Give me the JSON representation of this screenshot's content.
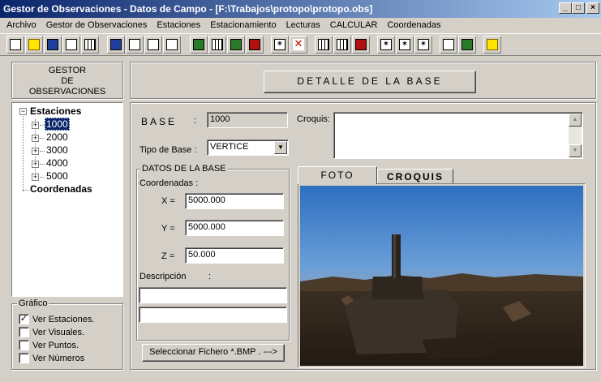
{
  "window": {
    "title": "Gestor de Observaciones - Datos de Campo - [F:\\Trabajos\\protopo\\protopo.obs]"
  },
  "menu": [
    "Archivo",
    "Gestor de Observaciones",
    "Estaciones",
    "Estacionamiento",
    "Lecturas",
    "CALCULAR",
    "Coordenadas"
  ],
  "left_panel": {
    "title_line1": "GESTOR",
    "title_line2": "DE",
    "title_line3": "OBSERVACIONES",
    "tree": {
      "root_label": "Estaciones",
      "stations": [
        "1000",
        "2000",
        "3000",
        "4000",
        "5000"
      ],
      "selected": "1000",
      "second_root": "Coordenadas"
    },
    "grafico": {
      "legend": "Gráfico",
      "options": [
        {
          "label": "Ver Estaciones.",
          "checked": true
        },
        {
          "label": "Ver Visuales.",
          "checked": false
        },
        {
          "label": "Ver Puntos.",
          "checked": false
        },
        {
          "label": "Ver Números",
          "checked": false
        }
      ]
    }
  },
  "header": {
    "button_label": "DETALLE DE LA BASE"
  },
  "base": {
    "label": "BASE",
    "colon": ":",
    "value": "1000",
    "tipo_label": "Tipo de Base :",
    "tipo_value": "VERTICE",
    "croquis_label": "Croquis:"
  },
  "datos": {
    "legend": "DATOS DE LA BASE",
    "coords_label": "Coordenadas  :",
    "x_label": "X =",
    "x_value": "5000.000",
    "y_label": "Y =",
    "y_value": "5000.000",
    "z_label": "Z =",
    "z_value": "50.000",
    "desc_label": "Descripción",
    "desc_colon": ":",
    "desc_line1": "",
    "desc_line2": ""
  },
  "select_button": "Seleccionar Fichero  *.BMP . --->",
  "tabs": {
    "foto": "FOTO",
    "croquis": "CROQUIS",
    "active": "FOTO"
  },
  "colors": {
    "title_start": "#0a246a",
    "title_end": "#a6caf0",
    "face": "#d4d0c8",
    "selection": "#0a246a"
  }
}
